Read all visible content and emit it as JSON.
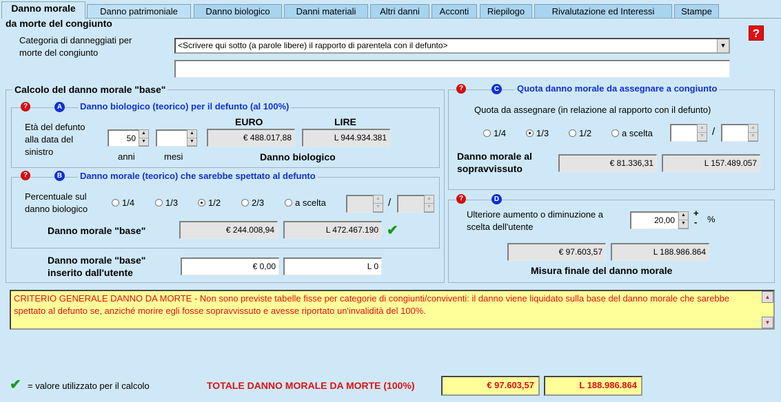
{
  "tabs": [
    {
      "label": "Danno morale"
    },
    {
      "label": "Danno patrimoniale"
    },
    {
      "label": "Danno biologico"
    },
    {
      "label": "Danni materiali"
    },
    {
      "label": "Altri danni"
    },
    {
      "label": "Acconti"
    },
    {
      "label": "Riepilogo"
    },
    {
      "label": "Rivalutazione ed Interessi"
    },
    {
      "label": "Stampe"
    }
  ],
  "header": {
    "subtitle": "da morte del congiunto",
    "help": "?"
  },
  "category": {
    "label_line1": "Categoria di danneggiati per",
    "label_line2": "morte del congiunto",
    "selected": "<Scrivere qui sotto (a parole libere) il rapporto di parentela con il defunto>",
    "free_text": ""
  },
  "base": {
    "title": "Calcolo del danno morale \"base\"",
    "sectionA": {
      "letter": "A",
      "title": "Danno biologico (teorico) per il defunto (al 100%)",
      "age_label_1": "Età del defunto",
      "age_label_2": "alla data del",
      "age_label_3": "sinistro",
      "years_value": "50",
      "months_value": "",
      "years_label": "anni",
      "months_label": "mesi",
      "euro_header": "EURO",
      "lire_header": "LIRE",
      "euro_value": "€ 488.017,88",
      "lire_value": "L 944.934.381",
      "caption": "Danno biologico"
    },
    "sectionB": {
      "letter": "B",
      "title": "Danno morale (teorico) che sarebbe spettato al defunto",
      "perc_label_1": "Percentuale sul",
      "perc_label_2": "danno biologico",
      "options": [
        "1/4",
        "1/3",
        "1/2",
        "2/3",
        "a scelta"
      ],
      "selected_index": 2,
      "num": "",
      "den": "",
      "slash": "/",
      "result_label": "Danno morale \"base\"",
      "euro_value": "€ 244.008,94",
      "lire_value": "L 472.467.190"
    },
    "user": {
      "label_1": "Danno morale \"base\"",
      "label_2": "inserito dall'utente",
      "euro_value": "€ 0,00",
      "lire_value": "L 0"
    }
  },
  "sectionC": {
    "letter": "C",
    "title": "Quota danno morale da assegnare a congiunto",
    "subtitle": "Quota da assegnare (in relazione al rapporto con il defunto)",
    "options": [
      "1/4",
      "1/3",
      "1/2",
      "a scelta"
    ],
    "selected_index": 1,
    "num": "",
    "den": "",
    "slash": "/",
    "result_label_1": "Danno morale al",
    "result_label_2": "sopravvissuto",
    "euro_value": "€ 81.336,31",
    "lire_value": "L 157.489.057"
  },
  "sectionD": {
    "letter": "D",
    "label_1": "Ulteriore aumento o diminuzione a",
    "label_2": "scelta dell'utente",
    "value": "20,00",
    "plus": "+",
    "minus": "-",
    "percent": "%",
    "euro_value": "€ 97.603,57",
    "lire_value": "L 188.986.864",
    "caption": "Misura finale del danno morale"
  },
  "note": {
    "text": "CRITERIO GENERALE DANNO DA MORTE - Non sono previste tabelle fisse per categorie di congiunti/conviventi: il danno viene liquidato sulla base del danno morale che sarebbe spettato al defunto se, anziché morire egli fosse sopravvissuto e avesse riportato un'invalidità del 100%."
  },
  "footer": {
    "legend": "= valore utilizzato per il calcolo",
    "total_label": "TOTALE DANNO MORALE DA MORTE (100%)",
    "total_euro": "€ 97.603,57",
    "total_lire": "L 188.986.864"
  },
  "colors": {
    "background": "#cfe8f7",
    "accent_blue": "#1030d0",
    "alert_red": "#e01010",
    "note_yellow": "#ffff99",
    "check_green": "#1a9a1a"
  }
}
